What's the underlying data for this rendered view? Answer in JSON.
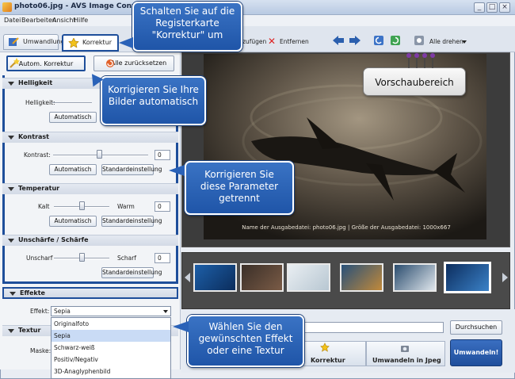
{
  "window": {
    "title": "photo06.jpg - AVS Image Converter",
    "controls": [
      "_",
      "□",
      "×"
    ]
  },
  "menu": [
    "Datei",
    "Bearbeiten",
    "Ansicht",
    "Hilfe"
  ],
  "tabs": {
    "conversion": "Umwandlung",
    "correction": "Korrektur"
  },
  "left": {
    "auto_correct": "Autom. Korrektur",
    "reset_all": "Alle zurücksetzen",
    "brightness": {
      "header": "Helligkeit",
      "label": "Helligkeit:",
      "auto": "Automatisch",
      "value": "0"
    },
    "contrast": {
      "header": "Kontrast",
      "label": "Kontrast:",
      "value": "0",
      "auto": "Automatisch",
      "default": "Standardeinstellung"
    },
    "temperature": {
      "header": "Temperatur",
      "left": "Kalt",
      "right": "Warm",
      "value": "0",
      "auto": "Automatisch",
      "default": "Standardeinstellung"
    },
    "sharpness": {
      "header": "Unschärfe / Schärfe",
      "left": "Unscharf",
      "right": "Scharf",
      "value": "0",
      "default": "Standardeinstellung"
    },
    "effects": {
      "header": "Effekte",
      "label": "Effekt:",
      "selected": "Sepia",
      "options": [
        "Originalfoto",
        "Sepia",
        "Schwarz-weiß",
        "Positiv/Negativ",
        "3D-Anaglyphenbild"
      ]
    },
    "texture": {
      "header": "Textur",
      "label": "Maske:"
    }
  },
  "toolbar": {
    "add": "zufügen",
    "remove": "Entfernen",
    "rotate_all": "Alle drehen"
  },
  "preview": {
    "caption": "Name der Ausgabedatei: photo06.jpg | Größe der Ausgabedatei: 1000x667"
  },
  "bottom": {
    "browse": "Durchsuchen",
    "step_correction": "Korrektur",
    "step_convert": "Umwandeln in Jpeg",
    "convert": "Umwandeln!"
  },
  "callouts": {
    "tab": "Schalten Sie auf die Registerkarte \"Korrektur\" um",
    "preview": "Vorschaubereich",
    "auto": "Korrigieren Sie Ihre Bilder automatisch",
    "params": "Korrigieren Sie diese Parameter getrennt",
    "effect": "Wählen Sie den gewünschten Effekt oder eine Textur"
  },
  "colors": {
    "callout_blue": "#2a62b8",
    "highlight_line": "#1e4e9a",
    "convert_button": "#1f4f9c"
  }
}
